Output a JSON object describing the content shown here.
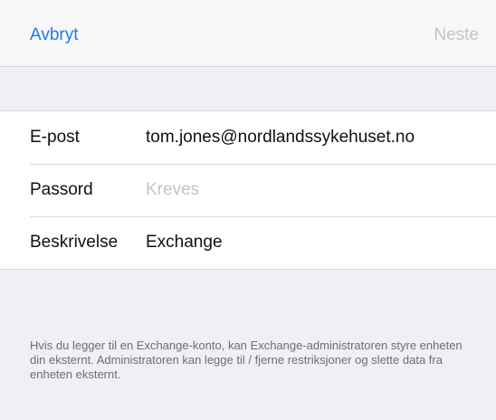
{
  "navbar": {
    "cancel_label": "Avbryt",
    "next_label": "Neste"
  },
  "form": {
    "rows": [
      {
        "label": "E-post",
        "value": "tom.jones@nordlandssykehuset.no",
        "placeholder": ""
      },
      {
        "label": "Passord",
        "value": "",
        "placeholder": "Kreves"
      },
      {
        "label": "Beskrivelse",
        "value": "Exchange",
        "placeholder": ""
      }
    ]
  },
  "footer": {
    "note": "Hvis du legger til en Exchange-konto, kan Exchange-administratoren styre enheten din eksternt. Administratoren kan legge til / fjerne restriksjoner og slette data fra enheten eksternt."
  },
  "colors": {
    "accent": "#1a7cf5",
    "disabled": "#c4c4c8",
    "background": "#efeff4"
  }
}
